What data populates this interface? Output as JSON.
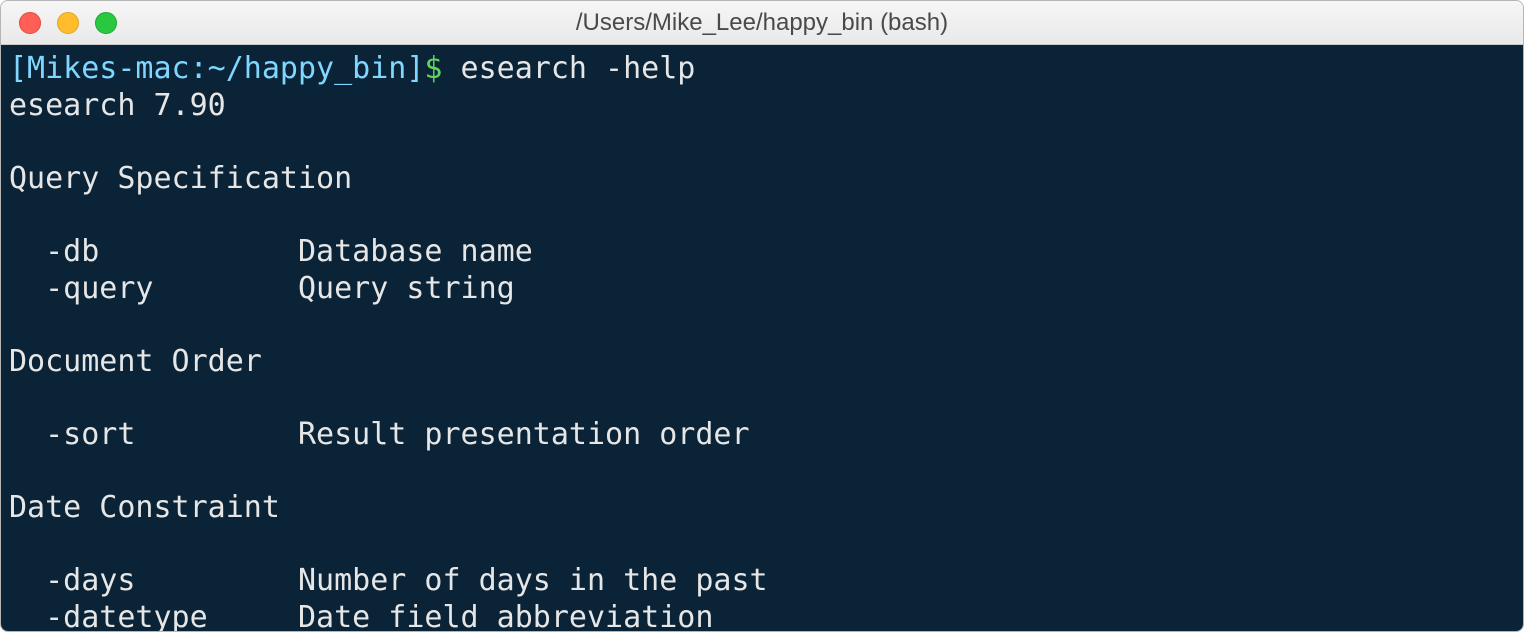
{
  "window": {
    "title": "/Users/Mike_Lee/happy_bin (bash)"
  },
  "terminal": {
    "prompt_host": "[Mikes-mac:~/happy_bin]",
    "prompt_symbol": "$",
    "command": "esearch -help",
    "output": {
      "version_line": "esearch 7.90",
      "sections": [
        {
          "heading": "Query Specification",
          "options": [
            {
              "flag": "-db",
              "desc": "Database name"
            },
            {
              "flag": "-query",
              "desc": "Query string"
            }
          ]
        },
        {
          "heading": "Document Order",
          "options": [
            {
              "flag": "-sort",
              "desc": "Result presentation order"
            }
          ]
        },
        {
          "heading": "Date Constraint",
          "options": [
            {
              "flag": "-days",
              "desc": "Number of days in the past"
            },
            {
              "flag": "-datetype",
              "desc": "Date field abbreviation"
            }
          ]
        }
      ]
    }
  }
}
